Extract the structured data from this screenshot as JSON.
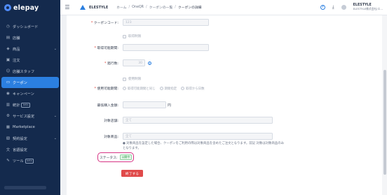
{
  "sidebar": {
    "brand": "elepay",
    "items": [
      {
        "label": "ダッシュボード",
        "icon": "clock-icon",
        "glyph": "◷",
        "chev": "",
        "badge": ""
      },
      {
        "label": "店舗",
        "icon": "store-icon",
        "glyph": "▤",
        "chev": "",
        "badge": ""
      },
      {
        "label": "商品",
        "icon": "tag-icon",
        "glyph": "◈",
        "chev": "⌄",
        "badge": ""
      },
      {
        "label": "注文",
        "icon": "document-icon",
        "glyph": "▣",
        "chev": "",
        "badge": ""
      },
      {
        "label": "店舗スタッフ",
        "icon": "user-icon",
        "glyph": "☺",
        "chev": "",
        "badge": ""
      },
      {
        "label": "クーポン",
        "icon": "coupon-icon",
        "glyph": "▭",
        "chev": "",
        "badge": ""
      },
      {
        "label": "キャンペーン",
        "icon": "megaphone-icon",
        "glyph": "◉",
        "chev": "",
        "badge": ""
      },
      {
        "label": "統計",
        "icon": "chart-icon",
        "glyph": "▥",
        "chev": "",
        "badge": "beta"
      },
      {
        "label": "サービス設定",
        "icon": "gear-icon",
        "glyph": "⚙",
        "chev": "⌄",
        "badge": ""
      },
      {
        "label": "Marketplace",
        "icon": "grid-icon",
        "glyph": "▦",
        "chev": "",
        "badge": ""
      },
      {
        "label": "契約設定",
        "icon": "contract-icon",
        "glyph": "▧",
        "chev": "⌄",
        "badge": ""
      },
      {
        "label": "言語設定",
        "icon": "language-icon",
        "glyph": "文",
        "chev": "",
        "badge": ""
      },
      {
        "label": "ツール",
        "icon": "wrench-icon",
        "glyph": "✎",
        "chev": "",
        "badge": "beta"
      }
    ],
    "active_index": 5
  },
  "header": {
    "store_name": "ELESTYLE",
    "breadcrumb": [
      "ホーム",
      "OneQR",
      "クーポンの一覧",
      "クーポンの詳細"
    ],
    "user_name": "ELESTYLE",
    "user_company": "ELESTYLE株式会社/エ..."
  },
  "form": {
    "coupon_code_label": "クーポンコード:",
    "coupon_code_value": "123",
    "acquire_limit_checkbox": "取得制限",
    "acquire_period_label": "取得可能期間:",
    "issue_count_label": "発行数:",
    "issue_count_value": "30",
    "use_limit_checkbox": "使用制限",
    "use_period_label": "使用可能期間:",
    "use_period_options": [
      "取得可能期間と同じ",
      "期間指定",
      "取得から日数"
    ],
    "min_amount_label": "最低購入金額:",
    "min_amount_unit": "円",
    "target_store_label": "対象店舗:",
    "target_store_value": "全て",
    "target_product_label": "対象商品:",
    "target_product_value": "全て",
    "note": "● 対象商品を設定した場合、クーポンをご利用の際は対象商品を含めたご注文となります。前記 対象は対象商品のみとなります。",
    "status_label": "ステータス:",
    "status_value": "公開中",
    "finish_button": "終了する"
  },
  "colors": {
    "sidebar_bg": "#142a4d",
    "accent": "#2b7fe0",
    "danger": "#e04a4a",
    "status_green": "#2e9e4a",
    "highlight": "#d63384"
  }
}
